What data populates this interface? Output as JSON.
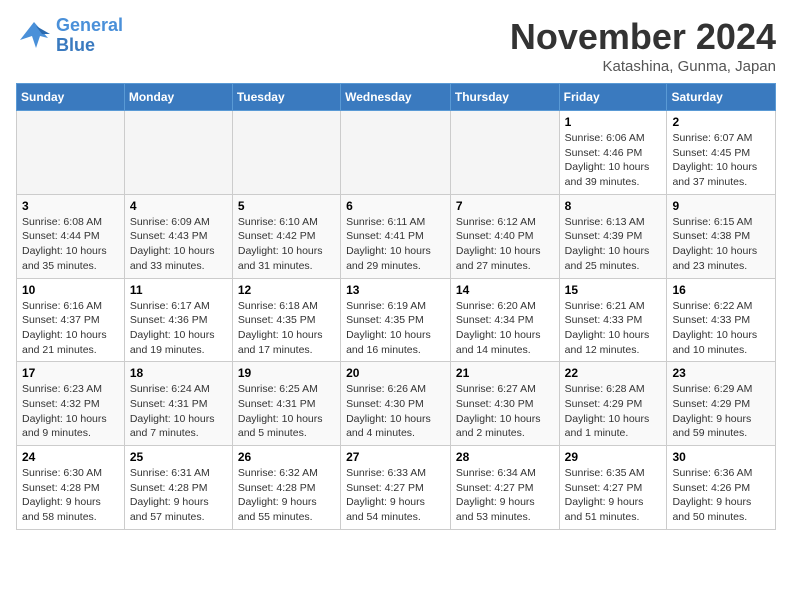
{
  "logo": {
    "line1": "General",
    "line2": "Blue"
  },
  "title": "November 2024",
  "location": "Katashina, Gunma, Japan",
  "days_of_week": [
    "Sunday",
    "Monday",
    "Tuesday",
    "Wednesday",
    "Thursday",
    "Friday",
    "Saturday"
  ],
  "weeks": [
    [
      {
        "day": "",
        "info": ""
      },
      {
        "day": "",
        "info": ""
      },
      {
        "day": "",
        "info": ""
      },
      {
        "day": "",
        "info": ""
      },
      {
        "day": "",
        "info": ""
      },
      {
        "day": "1",
        "info": "Sunrise: 6:06 AM\nSunset: 4:46 PM\nDaylight: 10 hours\nand 39 minutes."
      },
      {
        "day": "2",
        "info": "Sunrise: 6:07 AM\nSunset: 4:45 PM\nDaylight: 10 hours\nand 37 minutes."
      }
    ],
    [
      {
        "day": "3",
        "info": "Sunrise: 6:08 AM\nSunset: 4:44 PM\nDaylight: 10 hours\nand 35 minutes."
      },
      {
        "day": "4",
        "info": "Sunrise: 6:09 AM\nSunset: 4:43 PM\nDaylight: 10 hours\nand 33 minutes."
      },
      {
        "day": "5",
        "info": "Sunrise: 6:10 AM\nSunset: 4:42 PM\nDaylight: 10 hours\nand 31 minutes."
      },
      {
        "day": "6",
        "info": "Sunrise: 6:11 AM\nSunset: 4:41 PM\nDaylight: 10 hours\nand 29 minutes."
      },
      {
        "day": "7",
        "info": "Sunrise: 6:12 AM\nSunset: 4:40 PM\nDaylight: 10 hours\nand 27 minutes."
      },
      {
        "day": "8",
        "info": "Sunrise: 6:13 AM\nSunset: 4:39 PM\nDaylight: 10 hours\nand 25 minutes."
      },
      {
        "day": "9",
        "info": "Sunrise: 6:15 AM\nSunset: 4:38 PM\nDaylight: 10 hours\nand 23 minutes."
      }
    ],
    [
      {
        "day": "10",
        "info": "Sunrise: 6:16 AM\nSunset: 4:37 PM\nDaylight: 10 hours\nand 21 minutes."
      },
      {
        "day": "11",
        "info": "Sunrise: 6:17 AM\nSunset: 4:36 PM\nDaylight: 10 hours\nand 19 minutes."
      },
      {
        "day": "12",
        "info": "Sunrise: 6:18 AM\nSunset: 4:35 PM\nDaylight: 10 hours\nand 17 minutes."
      },
      {
        "day": "13",
        "info": "Sunrise: 6:19 AM\nSunset: 4:35 PM\nDaylight: 10 hours\nand 16 minutes."
      },
      {
        "day": "14",
        "info": "Sunrise: 6:20 AM\nSunset: 4:34 PM\nDaylight: 10 hours\nand 14 minutes."
      },
      {
        "day": "15",
        "info": "Sunrise: 6:21 AM\nSunset: 4:33 PM\nDaylight: 10 hours\nand 12 minutes."
      },
      {
        "day": "16",
        "info": "Sunrise: 6:22 AM\nSunset: 4:33 PM\nDaylight: 10 hours\nand 10 minutes."
      }
    ],
    [
      {
        "day": "17",
        "info": "Sunrise: 6:23 AM\nSunset: 4:32 PM\nDaylight: 10 hours\nand 9 minutes."
      },
      {
        "day": "18",
        "info": "Sunrise: 6:24 AM\nSunset: 4:31 PM\nDaylight: 10 hours\nand 7 minutes."
      },
      {
        "day": "19",
        "info": "Sunrise: 6:25 AM\nSunset: 4:31 PM\nDaylight: 10 hours\nand 5 minutes."
      },
      {
        "day": "20",
        "info": "Sunrise: 6:26 AM\nSunset: 4:30 PM\nDaylight: 10 hours\nand 4 minutes."
      },
      {
        "day": "21",
        "info": "Sunrise: 6:27 AM\nSunset: 4:30 PM\nDaylight: 10 hours\nand 2 minutes."
      },
      {
        "day": "22",
        "info": "Sunrise: 6:28 AM\nSunset: 4:29 PM\nDaylight: 10 hours\nand 1 minute."
      },
      {
        "day": "23",
        "info": "Sunrise: 6:29 AM\nSunset: 4:29 PM\nDaylight: 9 hours\nand 59 minutes."
      }
    ],
    [
      {
        "day": "24",
        "info": "Sunrise: 6:30 AM\nSunset: 4:28 PM\nDaylight: 9 hours\nand 58 minutes."
      },
      {
        "day": "25",
        "info": "Sunrise: 6:31 AM\nSunset: 4:28 PM\nDaylight: 9 hours\nand 57 minutes."
      },
      {
        "day": "26",
        "info": "Sunrise: 6:32 AM\nSunset: 4:28 PM\nDaylight: 9 hours\nand 55 minutes."
      },
      {
        "day": "27",
        "info": "Sunrise: 6:33 AM\nSunset: 4:27 PM\nDaylight: 9 hours\nand 54 minutes."
      },
      {
        "day": "28",
        "info": "Sunrise: 6:34 AM\nSunset: 4:27 PM\nDaylight: 9 hours\nand 53 minutes."
      },
      {
        "day": "29",
        "info": "Sunrise: 6:35 AM\nSunset: 4:27 PM\nDaylight: 9 hours\nand 51 minutes."
      },
      {
        "day": "30",
        "info": "Sunrise: 6:36 AM\nSunset: 4:26 PM\nDaylight: 9 hours\nand 50 minutes."
      }
    ]
  ]
}
